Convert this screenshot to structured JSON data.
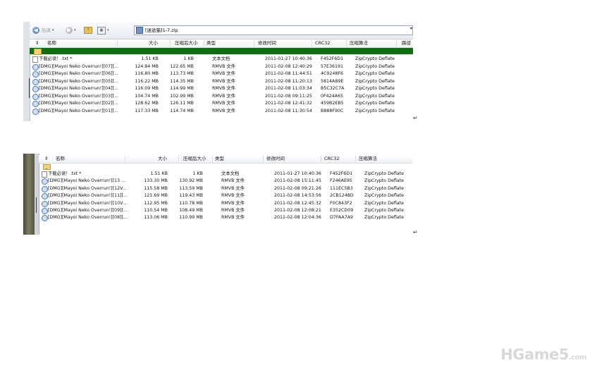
{
  "panel1": {
    "toolbar": {
      "back_label": "后退",
      "address": "[迷途猫]1-7.zip"
    },
    "columns": [
      "名称",
      "大小",
      "压缩后大小",
      "类型",
      "修改时间",
      "CRC32",
      "压缩算法",
      "路径"
    ],
    "parent_label": "..",
    "rows": [
      {
        "name": "下载必读！.txt *",
        "size": "1.51 KB",
        "packed": "1 KB",
        "type": "文本文档",
        "modified": "2011-01-27 10:40:36",
        "crc": "F452F6D1",
        "method": "ZipCrypto Deflate",
        "icon": "text-file-icon"
      },
      {
        "name": "[DMG][Mayoi Neko Overrun!][07][...",
        "size": "124.84 MB",
        "packed": "122.65 MB",
        "type": "RMVB 文件",
        "modified": "2011-02-08 12:40:29",
        "crc": "57E36191",
        "method": "ZipCrypto Deflate",
        "icon": "video-file-icon"
      },
      {
        "name": "[DMG][Mayoi Neko Overrun!][06][...",
        "size": "116.80 MB",
        "packed": "113.73 MB",
        "type": "RMVB 文件",
        "modified": "2011-02-08 11:44:51",
        "crc": "4C9248F6",
        "method": "ZipCrypto Deflate",
        "icon": "video-file-icon"
      },
      {
        "name": "[DMG][Mayoi Neko Overrun!][05][...",
        "size": "116.22 MB",
        "packed": "114.35 MB",
        "type": "RMVB 文件",
        "modified": "2011-02-08 11:20:13",
        "crc": "5814A89E",
        "method": "ZipCrypto Deflate",
        "icon": "video-file-icon"
      },
      {
        "name": "[DMG][Mayoi Neko Overrun!][04][...",
        "size": "116.09 MB",
        "packed": "114.99 MB",
        "type": "RMVB 文件",
        "modified": "2011-02-08 11:03:34",
        "crc": "B5C32C7A",
        "method": "ZipCrypto Deflate",
        "icon": "video-file-icon"
      },
      {
        "name": "[DMG][Mayoi Neko Overrun!][03][...",
        "size": "104.74 MB",
        "packed": "102.99 MB",
        "type": "RMVB 文件",
        "modified": "2011-02-08 09:11:25",
        "crc": "0F424A65",
        "method": "ZipCrypto Deflate",
        "icon": "video-file-icon"
      },
      {
        "name": "[DMG][Mayoi Neko Overrun!][02][...",
        "size": "128.62 MB",
        "packed": "126.11 MB",
        "type": "RMVB 文件",
        "modified": "2011-02-08 12:41:32",
        "crc": "459B2EB5",
        "method": "ZipCrypto Deflate",
        "icon": "video-file-icon"
      },
      {
        "name": "[DMG][Mayoi Neko Overrun!][01][...",
        "size": "117.33 MB",
        "packed": "114.74 MB",
        "type": "RMVB 文件",
        "modified": "2011-02-08 11:30:54",
        "crc": "B888F90C",
        "method": "ZipCrypto Deflate",
        "icon": "video-file-icon"
      }
    ]
  },
  "panel2": {
    "columns": [
      "名称",
      "大小",
      "压缩后大小",
      "类型",
      "修改时间",
      "CRC32",
      "压缩算法"
    ],
    "parent_label": "..",
    "rows": [
      {
        "name": "下载必读！.txt *",
        "size": "1.51 KB",
        "packed": "1 KB",
        "type": "文本文档",
        "modified": "2011-01-27 10:40:36",
        "crc": "F452F6D1",
        "method": "ZipCrypto Deflate",
        "icon": "text-file-icon"
      },
      {
        "name": "[DMG][Mayoi Neko Overrun!][13 ...",
        "size": "133.30 MB",
        "packed": "130.92 MB",
        "type": "RMVB 文件",
        "modified": "2011-02-08 15:11:45",
        "crc": "F246AE95",
        "method": "ZipCrypto Deflate",
        "icon": "video-file-icon"
      },
      {
        "name": "[DMG][Mayoi Neko Overrun!][12V...",
        "size": "115.58 MB",
        "packed": "113.59 MB",
        "type": "RMVB 文件",
        "modified": "2011-02-08 09:21:26",
        "crc": "111EC5B3",
        "method": "ZipCrypto Deflate",
        "icon": "video-file-icon"
      },
      {
        "name": "[DMG][Mayoi Neko Overrun!][11][...",
        "size": "121.69 MB",
        "packed": "119.43 MB",
        "type": "RMVB 文件",
        "modified": "2011-02-08 14:53:56",
        "crc": "2CB1248D",
        "method": "ZipCrypto Deflate",
        "icon": "video-file-icon"
      },
      {
        "name": "[DMG][Mayoi Neko Overrun!][10V...",
        "size": "112.95 MB",
        "packed": "110.78 MB",
        "type": "RMVB 文件",
        "modified": "2011-02-08 12:45:32",
        "crc": "F0C843F2",
        "method": "ZipCrypto Deflate",
        "icon": "video-file-icon"
      },
      {
        "name": "[DMG][Mayoi Neko Overrun!][09][...",
        "size": "110.54 MB",
        "packed": "108.49 MB",
        "type": "RMVB 文件",
        "modified": "2011-02-08 12:08:21",
        "crc": "E352CD09",
        "method": "ZipCrypto Deflate",
        "icon": "video-file-icon"
      },
      {
        "name": "[DMG][Mayoi Neko Overrun!][08][...",
        "size": "113.06 MB",
        "packed": "110.99 MB",
        "type": "RMVB 文件",
        "modified": "2011-02-08 12:04:36",
        "crc": "D7FAA7A9",
        "method": "ZipCrypto Deflate",
        "icon": "video-file-icon"
      }
    ]
  },
  "doc": {
    "return_mark": "↵"
  },
  "watermark": {
    "text": "HGame5",
    "suffix": ".com"
  },
  "colors": {
    "parent_row": "#0f6e0f",
    "window_chrome": "#e7ebf0"
  }
}
